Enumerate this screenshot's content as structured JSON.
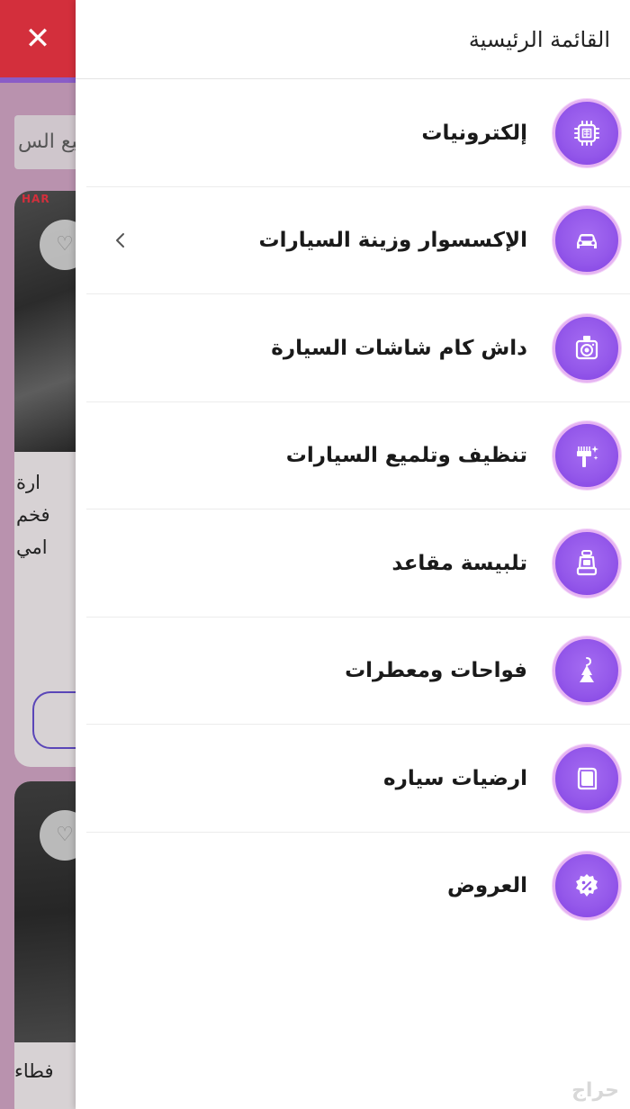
{
  "background_page": {
    "search_text": "لميع الس",
    "card1_logo": "HAR",
    "card1_text_lines": [
      "ارة",
      "فخم",
      "امي"
    ],
    "card2_text": "فطاء"
  },
  "drawer": {
    "title": "القائمة الرئيسية",
    "menu_items": [
      {
        "label": "إلكترونيات",
        "icon": "chip-icon",
        "has_submenu": false
      },
      {
        "label": "الإكسسوار وزينة السيارات",
        "icon": "car-icon",
        "has_submenu": true
      },
      {
        "label": "داش كام شاشات السيارة",
        "icon": "dashcam-icon",
        "has_submenu": false
      },
      {
        "label": "تنظيف وتلميع السيارات",
        "icon": "cleaning-spray-icon",
        "has_submenu": false
      },
      {
        "label": "تلبيسة مقاعد",
        "icon": "car-seat-icon",
        "has_submenu": false
      },
      {
        "label": "فواحات ومعطرات",
        "icon": "air-freshener-icon",
        "has_submenu": false
      },
      {
        "label": "ارضيات سياره",
        "icon": "floor-mat-icon",
        "has_submenu": false
      },
      {
        "label": "العروض",
        "icon": "discount-badge-icon",
        "has_submenu": false
      }
    ]
  },
  "watermark": "حراج",
  "colors": {
    "accent_purple": "#9458ea",
    "ring_pink": "#e6b3f2",
    "close_bar_red": "#d32f3c"
  }
}
